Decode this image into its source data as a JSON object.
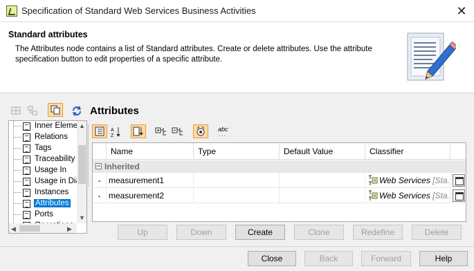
{
  "window": {
    "title": "Specification of Standard Web Services Business Activities",
    "close_glyph": "✕"
  },
  "header": {
    "title": "Standard attributes",
    "description": "The Attributes node contains a list of Standard attributes. Create or delete attributes. Use the attribute specification button to edit properties of a specific attribute."
  },
  "tree": {
    "items": [
      {
        "label": "Inner Eleme"
      },
      {
        "label": "Relations"
      },
      {
        "label": "Tags"
      },
      {
        "label": "Traceability"
      },
      {
        "label": "Usage In"
      },
      {
        "label": "Usage in Dia"
      },
      {
        "label": "Instances"
      },
      {
        "label": "Attributes",
        "selected": true
      },
      {
        "label": "Ports"
      },
      {
        "label": "Operations"
      }
    ]
  },
  "panel": {
    "title": "Attributes",
    "columns": [
      "Name",
      "Type",
      "Default Value",
      "Classifier"
    ],
    "group_label": "Inherited",
    "group_toggle": "−",
    "rows": [
      {
        "marker": "-",
        "name": "measurement1",
        "type": "",
        "default": "",
        "classifier": "Web Services",
        "classifier_suffix": "[Sta..."
      },
      {
        "marker": "-",
        "name": "measurement2",
        "type": "",
        "default": "",
        "classifier": "Web Services",
        "classifier_suffix": "[Sta..."
      }
    ],
    "abc_label": "abc",
    "buttons": {
      "up": "Up",
      "down": "Down",
      "create": "Create",
      "clone": "Clone",
      "redefine": "Redefine",
      "delete": "Delete"
    }
  },
  "footer": {
    "close": "Close",
    "back": "Back",
    "forward": "Forward",
    "help": "Help"
  },
  "colors": {
    "selection": "#0078d7",
    "toggle_on_bg": "#ffd9a6",
    "toggle_on_border": "#e89a3c"
  }
}
